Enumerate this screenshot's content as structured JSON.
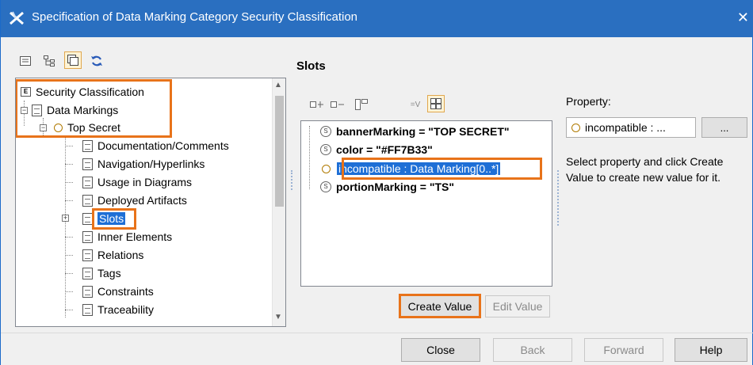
{
  "window": {
    "title": "Specification of Data Marking Category Security Classification",
    "close_glyph": "✕",
    "accent": "#2a6fc0",
    "highlight_color": "#e8731a"
  },
  "tree_toolbar": {
    "icons": [
      "list-view-icon",
      "tree-view-icon",
      "compartment-view-icon",
      "refresh-icon"
    ]
  },
  "tree": {
    "root": "Security Classification",
    "data_markings": "Data Markings",
    "top_secret": "Top Secret",
    "items": [
      "Documentation/Comments",
      "Navigation/Hyperlinks",
      "Usage in Diagrams",
      "Deployed Artifacts",
      "Slots",
      "Inner Elements",
      "Relations",
      "Tags",
      "Constraints",
      "Traceability"
    ]
  },
  "slots": {
    "heading": "Slots",
    "rows": [
      {
        "name": "bannerMarking = \"TOP SECRET\""
      },
      {
        "name": "color = \"#FF7B33\""
      },
      {
        "name": "incompatible : Data Marking[0..*]"
      },
      {
        "name": "portionMarking = \"TS\""
      }
    ],
    "create_value": "Create Value",
    "edit_value": "Edit Value"
  },
  "property": {
    "label": "Property:",
    "value": "incompatible : ...",
    "browse": "...",
    "help": "Select property and click Create Value to create new value for it."
  },
  "footer": {
    "close": "Close",
    "back": "Back",
    "forward": "Forward",
    "help": "Help"
  }
}
